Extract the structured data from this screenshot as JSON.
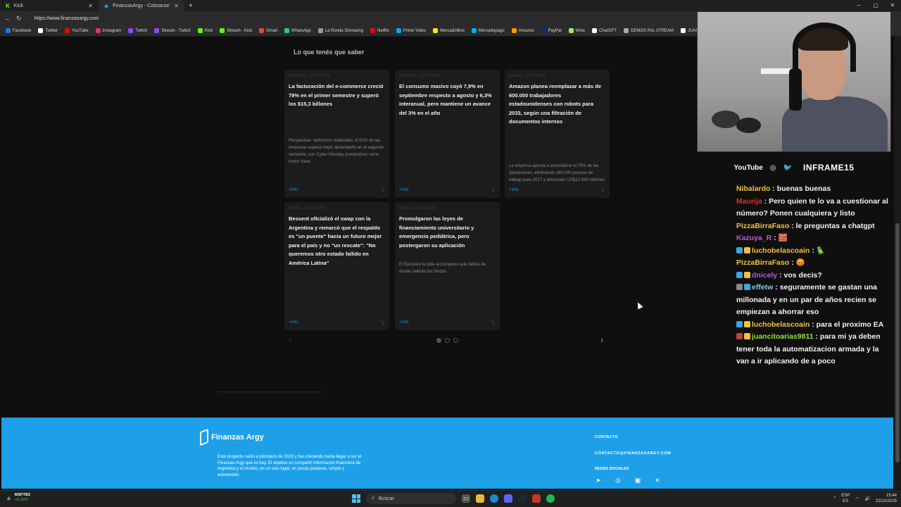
{
  "browser": {
    "tabs": [
      {
        "label": "Kick",
        "active": false,
        "color": "#53fc18"
      },
      {
        "label": "FinanzasArgy - Cotizaciones en tie",
        "active": true,
        "color": "#1ea0e8"
      }
    ],
    "url": "https://www.finanzasargy.com",
    "bookmarks": [
      {
        "label": "Facebook",
        "color": "#1877f2"
      },
      {
        "label": "Twitter",
        "color": "#ffffff"
      },
      {
        "label": "YouTube",
        "color": "#ff0000"
      },
      {
        "label": "Instagram",
        "color": "#e1306c"
      },
      {
        "label": "Twitch",
        "color": "#9146ff"
      },
      {
        "label": "Stream - Twitch",
        "color": "#9146ff"
      },
      {
        "label": "Kick",
        "color": "#53fc18"
      },
      {
        "label": "Stream - Kick",
        "color": "#53fc18"
      },
      {
        "label": "Gmail",
        "color": "#ea4335"
      },
      {
        "label": "WhatsApp",
        "color": "#25d366"
      },
      {
        "label": "La Ronda Simracing",
        "color": "#999999"
      },
      {
        "label": "Netflix",
        "color": "#e50914"
      },
      {
        "label": "Prime Video",
        "color": "#00a8e1"
      },
      {
        "label": "Mercadolibre",
        "color": "#ffe600"
      },
      {
        "label": "Mercadopago",
        "color": "#00b1ea"
      },
      {
        "label": "Amazon",
        "color": "#ff9900"
      },
      {
        "label": "PayPal",
        "color": "#003087"
      },
      {
        "label": "Wise",
        "color": "#9fe870"
      },
      {
        "label": "ChatGPT",
        "color": "#ffffff"
      },
      {
        "label": "DEMOS PAL STREAM",
        "color": "#aaaaaa"
      },
      {
        "label": "JUAN TUR",
        "color": "#ffffff"
      }
    ]
  },
  "page": {
    "section_title": "Lo que tenés que saber",
    "cards": [
      {
        "date": "Miércoles, 22/10/2025",
        "headline": "La facturación del e-commerce creció 79% en el primer semestre y superó los $15,3 billones",
        "desc": "Perspectiva: optimismo moderado; el 51% de las empresas espera mejor desempeño en el segundo semestre, con Cyber Monday (noviembre) como motor clave",
        "more": "+Info"
      },
      {
        "date": "Miércoles, 22/10/2025",
        "headline": "El consumo masivo cayó 7,9% en septiembre respecto a agosto y 6,3% interanual, pero mantiene un avance del 3% en el año",
        "desc": "",
        "more": "+Info"
      },
      {
        "date": "Martes, 21/10/2025",
        "headline": "Amazon planea reemplazar a más de 600.000 trabajadores estadounidenses con robots para 2033, según una filtración de documentos internos",
        "desc": "La empresa apunta a automatizar el 75% de las operaciones, eliminando 160.000 puestos de trabajo para 2027 y ahorrando US$12.600 millones",
        "more": "+Info"
      },
      {
        "date": "Martes, 21/10/2025",
        "headline": "Bessent oficializó el swap con la Argentina y remarcó que el respaldo es \"un puente\" hacia un futuro mejor para el país y no \"un rescate\": \"No queremos otro estado fallido en América Latina\"",
        "desc": "",
        "more": "+Info"
      },
      {
        "date": "Martes, 21/10/2025",
        "headline": "Promulgaron las leyes de financiamiento universitario y emergencia pediátrica, pero postergaron su aplicación",
        "desc": "El Ejecutivo le pide al Congreso que defina de donde saldrán los fondos",
        "more": "+Info"
      }
    ],
    "carousel": {
      "pages": 3,
      "active": 0
    }
  },
  "footer": {
    "logo_text": "Finanzas Argy",
    "about": "Este proyecto nació a principios de 2020 y fue creciendo hasta llegar a ser el Finanzas Argy que es hoy. El objetivo es compartir información financiera de Argentina y el mundo, en un solo lugar, en pocas palabras, simple y entretenido.",
    "contact_heading": "CONTACTO",
    "contact_email": "CONTACTO@FINANZASARGY.COM",
    "social_heading": "REDES SOCIALES",
    "social_icons": [
      "telegram-icon",
      "instagram-icon",
      "linkedin-icon",
      "x-icon"
    ]
  },
  "stream": {
    "brand_youtube": "YouTube",
    "brand_name": "INFRAME15",
    "chat": [
      {
        "user": "Nibalardo",
        "color": "#f0c23a",
        "text": "buenas buenas",
        "badges": []
      },
      {
        "user": "Maurija",
        "color": "#e0302c",
        "text": "Pero quien te lo va a cuestionar al número? Ponen cualquiera y listo",
        "badges": []
      },
      {
        "user": "PizzaBirraFaso",
        "color": "#f0c23a",
        "text": "le preguntas a chatgpt",
        "badges": []
      },
      {
        "user": "Kazuya_R",
        "color": "#b45cd6",
        "text": "🧱",
        "badges": []
      },
      {
        "user": "luchobelascoain",
        "color": "#f0c23a",
        "text": "🦜",
        "badges": [
          "#3aa7e0",
          "#f0c23a"
        ]
      },
      {
        "user": "PizzaBirraFaso",
        "color": "#f0c23a",
        "text": "😡",
        "badges": []
      },
      {
        "user": "dnicely",
        "color": "#b45cd6",
        "text": "vos decis?",
        "badges": [
          "#3aa7e0",
          "#f0c23a"
        ]
      },
      {
        "user": "effetw",
        "color": "#7fc8f0",
        "text": "seguramente se gastan una millonada y en un par de años recien se empiezan a ahorrar eso",
        "badges": [
          "#888888",
          "#3aa7e0"
        ]
      },
      {
        "user": "luchobelascoain",
        "color": "#f0c23a",
        "text": "para el proximo EA",
        "badges": [
          "#3aa7e0",
          "#f0c23a"
        ]
      },
      {
        "user": "juancitoarias9811",
        "color": "#8fe03a",
        "text": "para mi ya deben tener toda la automatizacion armada y la van a ir aplicando de a poco",
        "badges": [
          "#c04040",
          "#f0c23a"
        ]
      }
    ]
  },
  "taskbar": {
    "stock_symbol": "MSFTBZ",
    "stock_change": "+0,30%",
    "search_placeholder": "Buscar",
    "lang_line1": "ESP",
    "lang_line2": "ES",
    "time": "15:44",
    "date": "22/10/2025"
  },
  "colors": {
    "footer_bg": "#1ea0e8",
    "page_bg": "#0f0f0f",
    "card_bg": "#1c1c1c",
    "link": "#1e8fd6"
  }
}
